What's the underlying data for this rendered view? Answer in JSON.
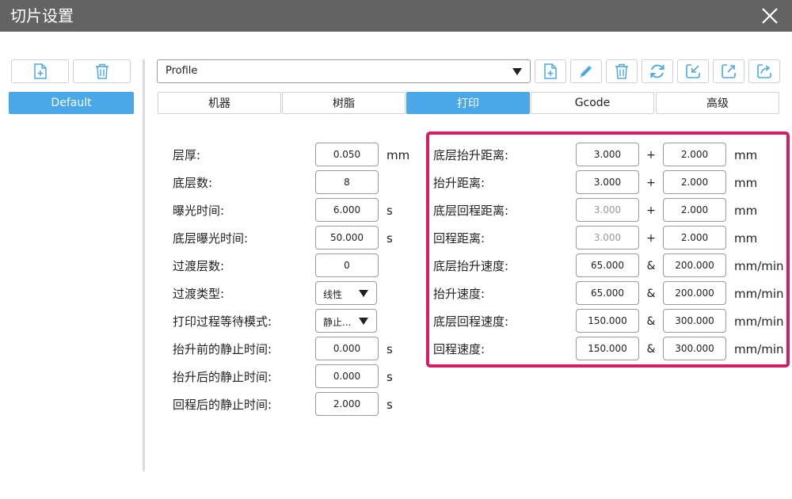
{
  "window": {
    "title": "切片设置"
  },
  "sidebar": {
    "profiles": [
      {
        "label": "Default"
      }
    ]
  },
  "toolbar": {
    "profile_value": "Profile"
  },
  "tabs": [
    {
      "label": "机器"
    },
    {
      "label": "树脂"
    },
    {
      "label": "打印"
    },
    {
      "label": "Gcode"
    },
    {
      "label": "高级"
    }
  ],
  "left_settings": [
    {
      "label": "层厚:",
      "value": "0.050",
      "unit": "mm"
    },
    {
      "label": "底层数:",
      "value": "8",
      "unit": ""
    },
    {
      "label": "曝光时间:",
      "value": "6.000",
      "unit": "s"
    },
    {
      "label": "底层曝光时间:",
      "value": "50.000",
      "unit": "s"
    },
    {
      "label": "过渡层数:",
      "value": "0",
      "unit": ""
    },
    {
      "label": "过渡类型:",
      "value": "线性",
      "unit": ""
    },
    {
      "label": "打印过程等待模式:",
      "value": "静止...",
      "unit": ""
    },
    {
      "label": "抬升前的静止时间:",
      "value": "0.000",
      "unit": "s"
    },
    {
      "label": "抬升后的静止时间:",
      "value": "0.000",
      "unit": "s"
    },
    {
      "label": "回程后的静止时间:",
      "value": "2.000",
      "unit": "s"
    }
  ],
  "right_settings": [
    {
      "label": "底层抬升距离:",
      "value1": "3.000",
      "op": "+",
      "value2": "2.000",
      "unit": "mm"
    },
    {
      "label": "抬升距离:",
      "value1": "3.000",
      "op": "+",
      "value2": "2.000",
      "unit": "mm"
    },
    {
      "label": "底层回程距离:",
      "value1": "3.000",
      "op": "+",
      "value2": "2.000",
      "unit": "mm"
    },
    {
      "label": "回程距离:",
      "value1": "3.000",
      "op": "+",
      "value2": "2.000",
      "unit": "mm"
    },
    {
      "label": "底层抬升速度:",
      "value1": "65.000",
      "op": "&",
      "value2": "200.000",
      "unit": "mm/min"
    },
    {
      "label": "抬升速度:",
      "value1": "65.000",
      "op": "&",
      "value2": "200.000",
      "unit": "mm/min"
    },
    {
      "label": "底层回程速度:",
      "value1": "150.000",
      "op": "&",
      "value2": "300.000",
      "unit": "mm/min"
    },
    {
      "label": "回程速度:",
      "value1": "150.000",
      "op": "&",
      "value2": "300.000",
      "unit": "mm/min"
    }
  ],
  "colors": {
    "accent": "#4aa8e8",
    "highlight": "#d61c63",
    "titlebar": "#636363"
  }
}
